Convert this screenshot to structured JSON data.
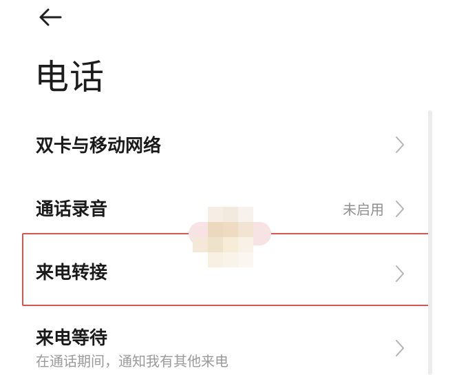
{
  "header": {
    "back_icon": "arrow-left-icon",
    "title": "电话"
  },
  "settings": [
    {
      "id": "dual-sim",
      "title": "双卡与移动网络",
      "status": "",
      "subtitle": "",
      "chevron_icon": "chevron-right-icon"
    },
    {
      "id": "call-recording",
      "title": "通话录音",
      "status": "未启用",
      "subtitle": "",
      "chevron_icon": "chevron-right-icon"
    },
    {
      "id": "call-forwarding",
      "title": "来电转接",
      "status": "",
      "subtitle": "",
      "chevron_icon": "chevron-right-icon",
      "highlighted": true
    },
    {
      "id": "call-waiting",
      "title": "来电等待",
      "status": "",
      "subtitle": "在通话期间，通知我有其他来电",
      "chevron_icon": "chevron-right-icon"
    }
  ],
  "colors": {
    "highlight_border": "#d9534f",
    "primary_text": "#1a1a1a",
    "secondary_text": "#9a9a9a",
    "chevron": "#b3b3b3"
  }
}
